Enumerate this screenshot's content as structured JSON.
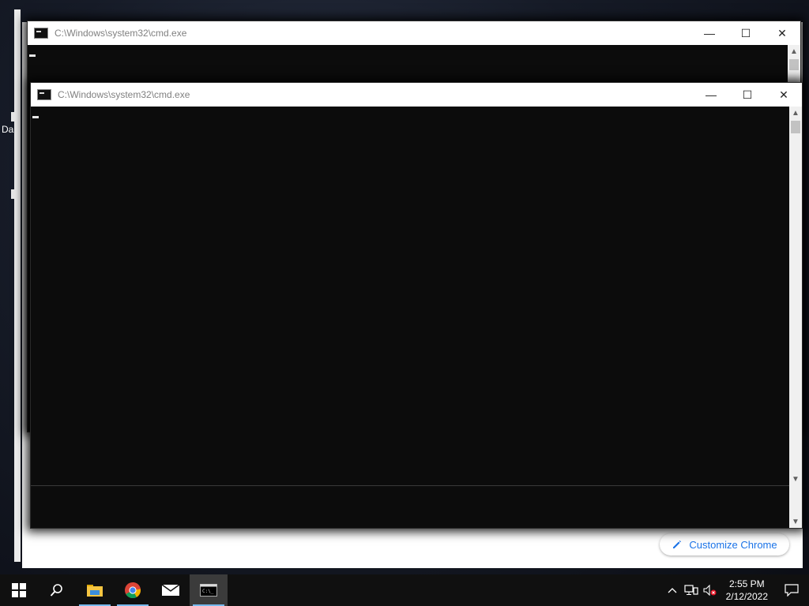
{
  "desktop": {
    "partial_label": "Da"
  },
  "cmd_back": {
    "title": "C:\\Windows\\system32\\cmd.exe"
  },
  "cmd_front": {
    "title": "C:\\Windows\\system32\\cmd.exe"
  },
  "window_controls": {
    "minimize": "—",
    "maximize": "☐",
    "close": "✕"
  },
  "chrome": {
    "customize_label": "Customize Chrome"
  },
  "taskbar": {
    "apps": [
      {
        "icon": "windows-start-icon"
      },
      {
        "icon": "search-icon"
      },
      {
        "icon": "file-explorer-icon"
      },
      {
        "icon": "chrome-icon"
      },
      {
        "icon": "mail-icon"
      },
      {
        "icon": "command-prompt-icon"
      }
    ],
    "clock_time": "2:55 PM",
    "clock_date": "2/12/2022"
  },
  "colors": {
    "accent": "#76b9ed",
    "chrome_blue": "#1a73e8",
    "console_bg": "#0c0c0c"
  }
}
